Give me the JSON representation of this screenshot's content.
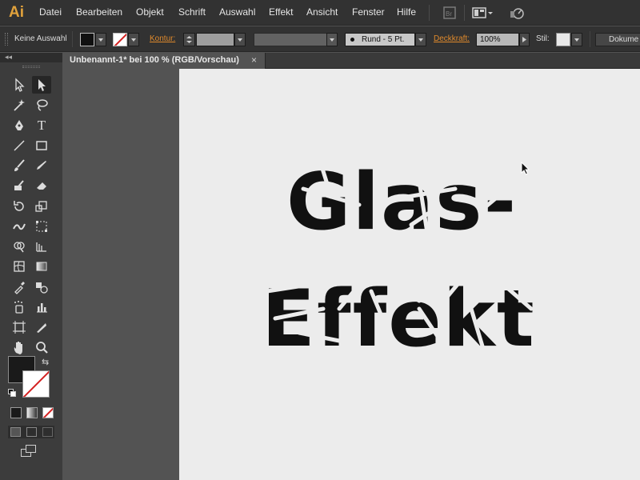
{
  "app": {
    "logo_text": "Ai",
    "menu": [
      "Datei",
      "Bearbeiten",
      "Objekt",
      "Schrift",
      "Auswahl",
      "Effekt",
      "Ansicht",
      "Fenster",
      "Hilfe"
    ]
  },
  "control_bar": {
    "selection_status": "Keine Auswahl",
    "stroke_label": "Kontur:",
    "brush_label": "Rund - 5 Pt.",
    "opacity_label": "Deckkraft:",
    "opacity_value": "100%",
    "style_label": "Stil:",
    "document_button": "Dokume"
  },
  "document": {
    "tab_title": "Unbenannt-1* bei 100 % (RGB/Vorschau)",
    "close_symbol": "×"
  },
  "artwork": {
    "line1": "Glas-",
    "line2": "Effekt",
    "fill_color": "#111111"
  },
  "colors": {
    "menu_bg": "#323232",
    "panel_bg": "#3c3c3c",
    "workspace_bg": "#535353",
    "artboard_bg": "#ececec",
    "accent_orange": "#e08a2c",
    "logo_color": "#e1a23c"
  }
}
